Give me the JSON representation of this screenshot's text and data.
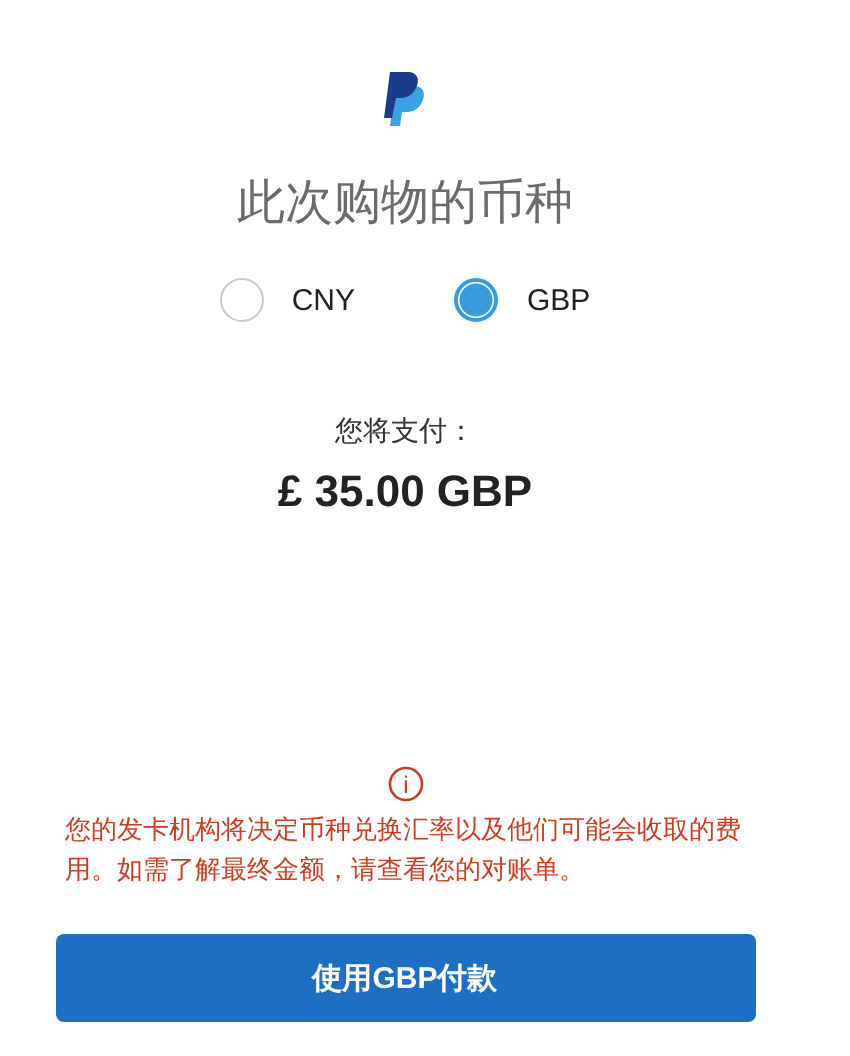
{
  "title": "此次购物的币种",
  "currencies": [
    {
      "label": "CNY",
      "selected": false
    },
    {
      "label": "GBP",
      "selected": true
    }
  ],
  "payment": {
    "label": "您将支付：",
    "amount": "£ 35.00 GBP"
  },
  "notice": {
    "icon": "i",
    "text": "您的发卡机构将决定币种兑换汇率以及他们可能会收取的费用。如需了解最终金额，请查看您的对账单。"
  },
  "button": {
    "label": "使用GBP付款"
  }
}
